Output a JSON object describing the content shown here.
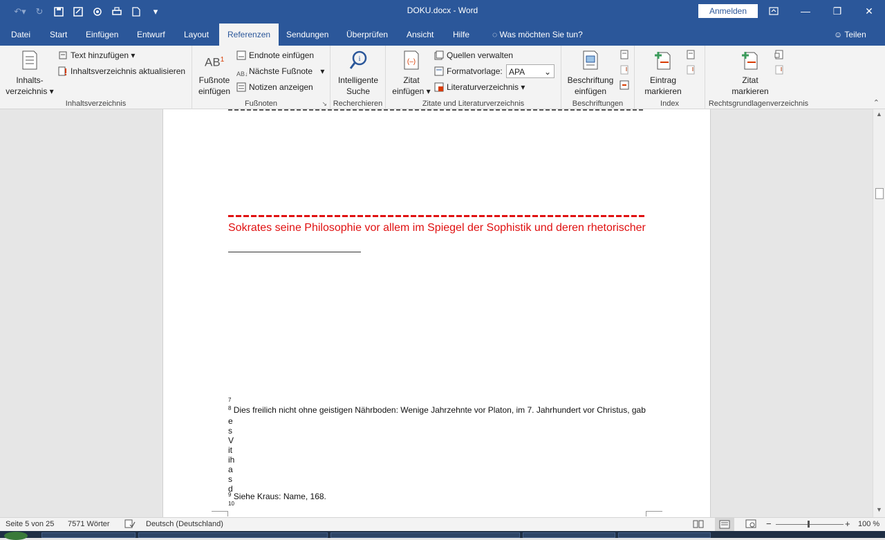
{
  "window": {
    "title": "DOKU.docx  -  Word",
    "signin_label": "Anmelden"
  },
  "quick_access": [
    "undo-icon",
    "redo-icon",
    "save-icon",
    "save-as-icon",
    "touch-mode-icon",
    "print-icon",
    "new-document-icon",
    "customize-icon"
  ],
  "tabs": [
    {
      "label": "Datei"
    },
    {
      "label": "Start"
    },
    {
      "label": "Einfügen"
    },
    {
      "label": "Entwurf"
    },
    {
      "label": "Layout"
    },
    {
      "label": "Referenzen"
    },
    {
      "label": "Sendungen"
    },
    {
      "label": "Überprüfen"
    },
    {
      "label": "Ansicht"
    },
    {
      "label": "Hilfe"
    }
  ],
  "tell_me": "Was möchten Sie tun?",
  "share_label": "Teilen",
  "ribbon": {
    "toc": {
      "big_label_1": "Inhalts-",
      "big_label_2": "verzeichnis",
      "add_text": "Text hinzufügen",
      "update_toc": "Inhaltsverzeichnis aktualisieren",
      "group": "Inhaltsverzeichnis"
    },
    "footnotes": {
      "icon_text": "AB",
      "big_label_1": "Fußnote",
      "big_label_2": "einfügen",
      "insert_endnote": "Endnote einfügen",
      "next_footnote": "Nächste Fußnote",
      "show_notes": "Notizen anzeigen",
      "group": "Fußnoten"
    },
    "research": {
      "big_label_1": "Intelligente",
      "big_label_2": "Suche",
      "group": "Recherchieren"
    },
    "citations": {
      "big_label_1": "Zitat",
      "big_label_2": "einfügen",
      "manage_sources": "Quellen verwalten",
      "style_label": "Formatvorlage:",
      "style_value": "APA",
      "bibliography": "Literaturverzeichnis",
      "group": "Zitate und Literaturverzeichnis"
    },
    "captions": {
      "big_label_1": "Beschriftung",
      "big_label_2": "einfügen",
      "group": "Beschriftungen"
    },
    "index": {
      "big_label_1": "Eintrag",
      "big_label_2": "markieren",
      "group": "Index"
    },
    "authorities": {
      "big_label_1": "Zitat",
      "big_label_2": "markieren",
      "group": "Rechtsgrundlagenverzeichnis"
    }
  },
  "document": {
    "red_line_2": "Sokrates seine Philosophie vor allem im Spiegel der Sophistik und deren rhetorischer",
    "fn7_num": "7",
    "fn8_num": "8",
    "fn8_text": "Dies freilich nicht ohne geistigen Nährboden: Wenige Jahrzehnte vor Platon, im 7. Jahrhundert vor Christus, gab",
    "fn8_letters": [
      "e",
      "s",
      "V",
      "it",
      "ih",
      "a",
      "s",
      "d"
    ],
    "fn9_num": "9",
    "fn9_text": "Siehe Kraus: Name, 168.",
    "fn10_num": "10"
  },
  "status": {
    "page": "Seite 5 von 25",
    "words": "7571 Wörter",
    "language": "Deutsch (Deutschland)",
    "zoom": "100 %"
  }
}
